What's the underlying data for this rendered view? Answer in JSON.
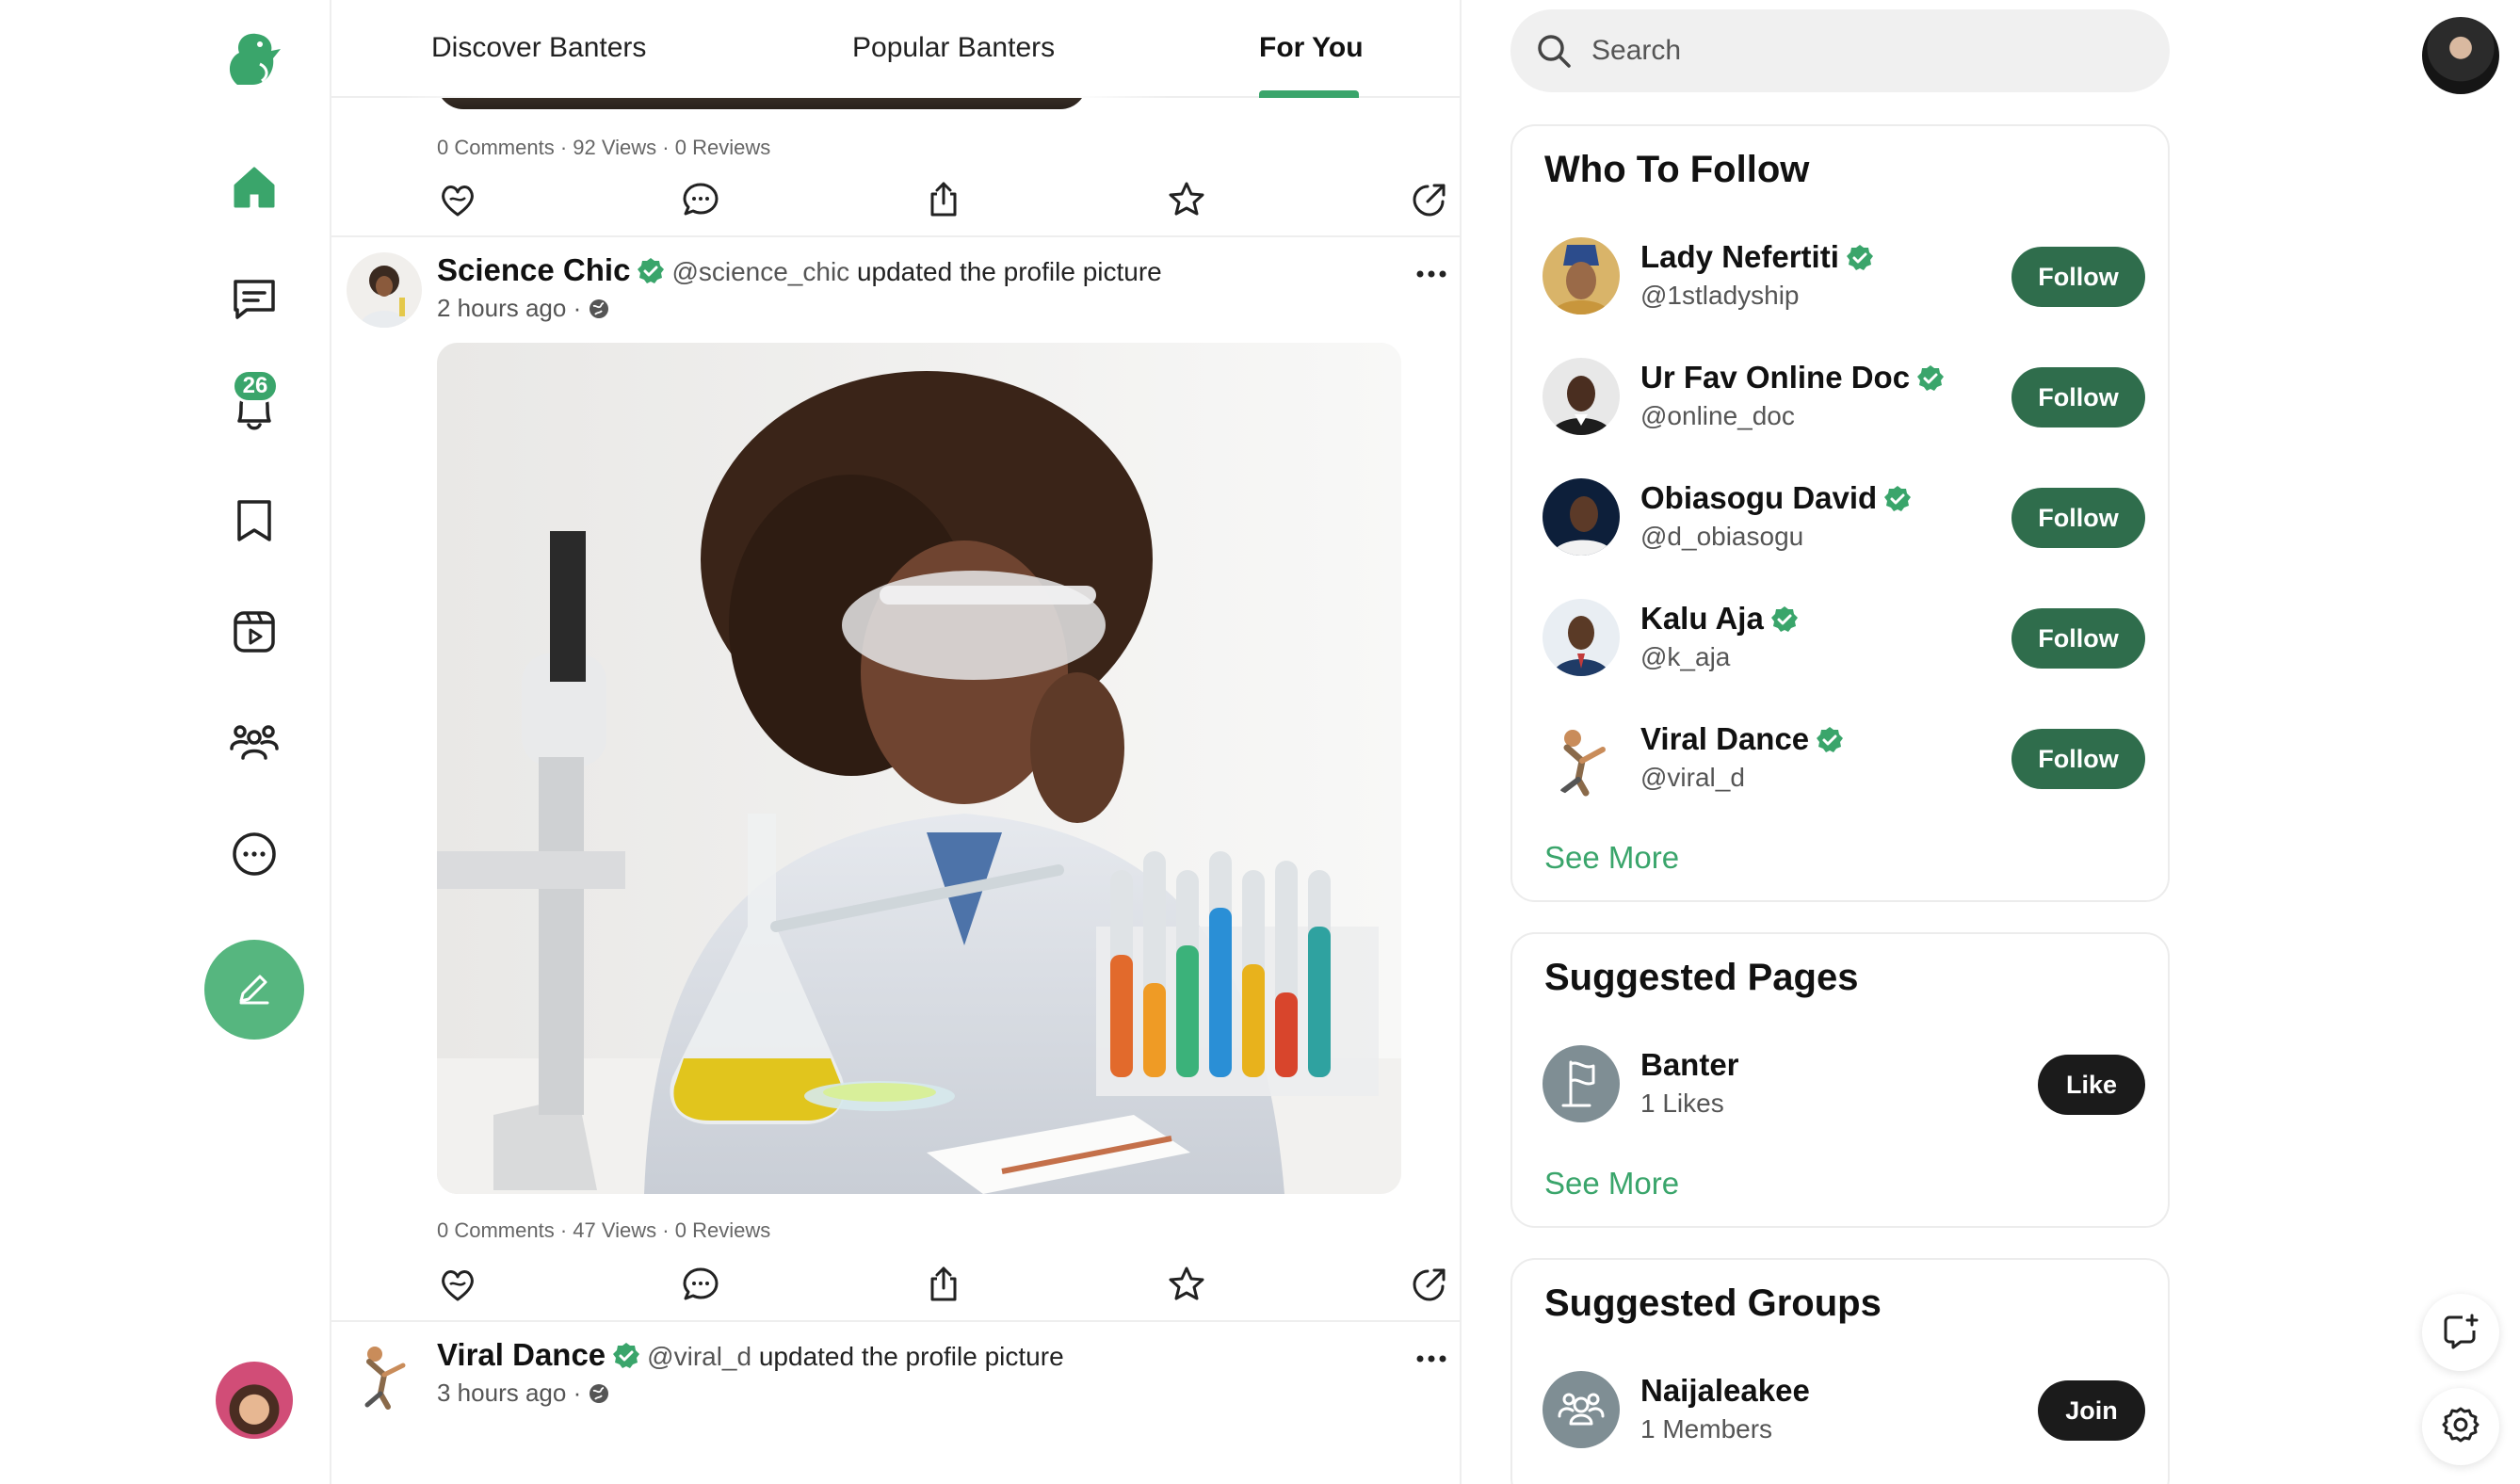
{
  "colors": {
    "accent": "#3aa56b",
    "follow_button": "#2f6d4c",
    "dark_button": "#1b1b1b"
  },
  "sidebar": {
    "items": [
      {
        "icon": "home-icon"
      },
      {
        "icon": "chat-icon"
      },
      {
        "icon": "notifications-icon",
        "badge": "26"
      },
      {
        "icon": "bookmark-icon"
      },
      {
        "icon": "video-icon"
      },
      {
        "icon": "people-icon"
      },
      {
        "icon": "more-icon"
      }
    ],
    "compose_icon": "pencil-icon"
  },
  "tabs": [
    {
      "label": "Discover Banters"
    },
    {
      "label": "Popular Banters"
    },
    {
      "label": "For You",
      "active": true
    }
  ],
  "feed": {
    "prev_post_stats": {
      "comments": "0 Comments",
      "views": "92 Views",
      "reviews": "0 Reviews"
    },
    "posts": [
      {
        "name": "Science Chic",
        "handle": "@science_chic",
        "action": "updated the profile picture",
        "time": "2 hours ago",
        "stats": {
          "comments": "0 Comments",
          "views": "47 Views",
          "reviews": "0 Reviews"
        }
      },
      {
        "name": "Viral Dance",
        "handle": "@viral_d",
        "action": "updated the profile picture",
        "time": "3 hours ago"
      }
    ],
    "separator": "·"
  },
  "search": {
    "placeholder": "Search"
  },
  "who_to_follow": {
    "title": "Who To Follow",
    "users": [
      {
        "name": "Lady Nefertiti",
        "handle": "@1stladyship",
        "button": "Follow"
      },
      {
        "name": "Ur Fav Online Doc",
        "handle": "@online_doc",
        "button": "Follow"
      },
      {
        "name": "Obiasogu David",
        "handle": "@d_obiasogu",
        "button": "Follow"
      },
      {
        "name": "Kalu Aja",
        "handle": "@k_aja",
        "button": "Follow"
      },
      {
        "name": "Viral Dance",
        "handle": "@viral_d",
        "button": "Follow"
      }
    ],
    "see_more": "See More"
  },
  "suggested_pages": {
    "title": "Suggested Pages",
    "items": [
      {
        "name": "Banter",
        "meta": "1 Likes",
        "button": "Like"
      }
    ],
    "see_more": "See More"
  },
  "suggested_groups": {
    "title": "Suggested Groups",
    "items": [
      {
        "name": "Naijaleakee",
        "meta": "1 Members",
        "button": "Join"
      }
    ]
  }
}
